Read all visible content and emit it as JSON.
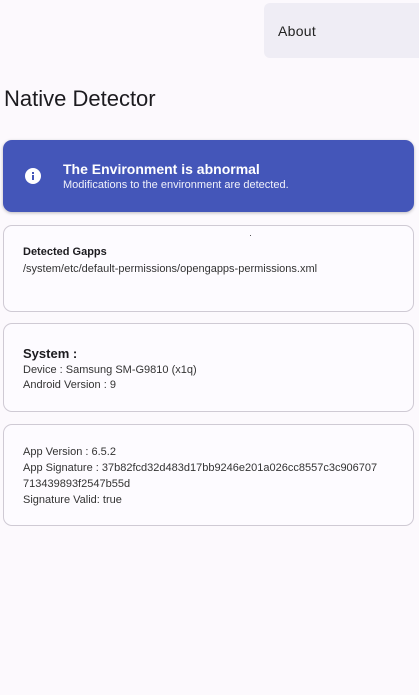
{
  "menu": {
    "about_label": "About"
  },
  "header": {
    "title": "Native Detector"
  },
  "banner": {
    "icon": "info-icon",
    "title": "The Environment is abnormal",
    "subtitle": "Modifications to the environment are detected.",
    "color": "#4456b9"
  },
  "gapps": {
    "heading": "Detected Gapps",
    "path": "/system/etc/default-permissions/opengapps-permissions.xml"
  },
  "system": {
    "heading": "System :",
    "device": "Device : Samsung SM-G9810  (x1q)",
    "android_version": "Android Version : 9"
  },
  "app": {
    "version": "App Version : 6.5.2",
    "signature_line1": "App Signature : 37b82fcd32d483d17bb9246e201a026cc8557c3c906707",
    "signature_line2": "713439893f2547b55d",
    "signature_valid": "Signature Valid: true"
  }
}
